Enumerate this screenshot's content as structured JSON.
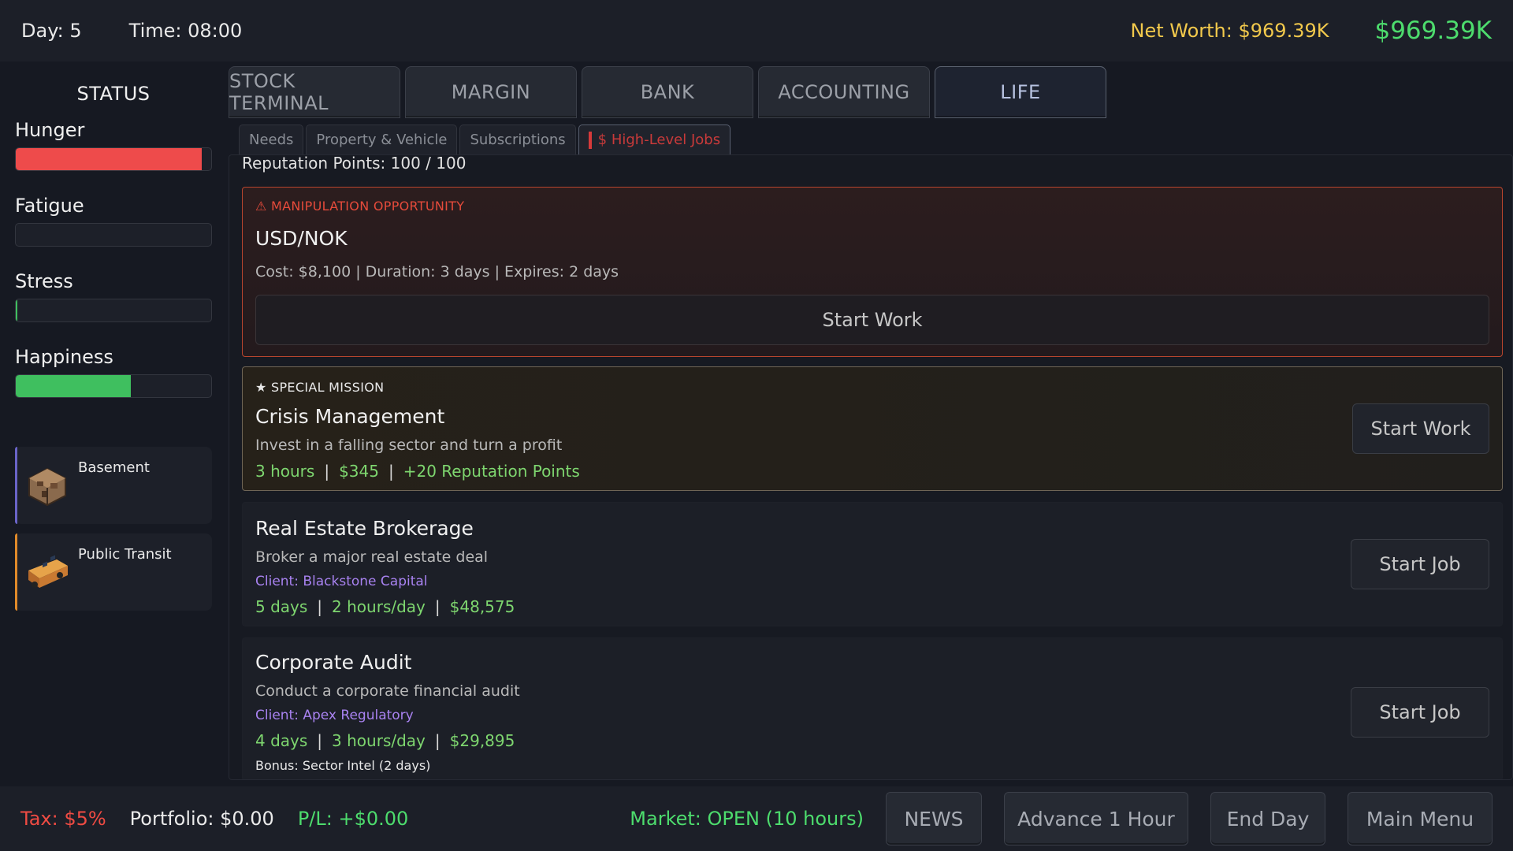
{
  "topbar": {
    "day": "Day: 5",
    "time": "Time: 08:00",
    "net_worth": "Net Worth: $969.39K",
    "cash": "$969.39K"
  },
  "sidebar": {
    "title": "STATUS",
    "meters": [
      {
        "label": "Hunger",
        "level": 0.95,
        "color": "#ee4b4b"
      },
      {
        "label": "Fatigue",
        "level": 0.0,
        "color": "#3fbf5f"
      },
      {
        "label": "Stress",
        "level": 0.005,
        "color": "#3fbf5f"
      },
      {
        "label": "Happiness",
        "level": 0.59,
        "color": "#3fbf5f"
      }
    ],
    "assets": [
      {
        "name": "Basement",
        "icon": "basement-room-icon",
        "accent": "#6a64c8"
      },
      {
        "name": "Public Transit",
        "icon": "bus-icon",
        "accent": "#e08a2a"
      }
    ]
  },
  "tabs": {
    "main": [
      "STOCK TERMINAL",
      "MARGIN",
      "BANK",
      "ACCOUNTING",
      "LIFE"
    ],
    "active_main": "LIFE",
    "sub": [
      "Needs",
      "Property & Vehicle",
      "Subscriptions",
      "$ High-Level Jobs"
    ],
    "active_sub": "$ High-Level Jobs"
  },
  "panel": {
    "reputation": "Reputation Points: 100 / 100",
    "manipulation": {
      "tag": "⚠ MANIPULATION OPPORTUNITY",
      "title": "USD/NOK",
      "details": "Cost: $8,100 | Duration: 3 days | Expires: 2 days",
      "button": "Start Work"
    },
    "special": {
      "tag": "★ SPECIAL MISSION",
      "title": "Crisis Management",
      "desc": "Invest in a falling sector and turn a profit",
      "stats": [
        "3 hours",
        "$345",
        "+20 Reputation Points"
      ],
      "button": "Start Work"
    },
    "jobs": [
      {
        "title": "Real Estate Brokerage",
        "desc": "Broker a major real estate deal",
        "client": "Client: Blackstone Capital",
        "stats": [
          "5 days",
          "2 hours/day",
          "$48,575"
        ],
        "bonus": "",
        "button": "Start Job"
      },
      {
        "title": "Corporate Audit",
        "desc": "Conduct a corporate financial audit",
        "client": "Client: Apex Regulatory",
        "stats": [
          "4 days",
          "3 hours/day",
          "$29,895"
        ],
        "bonus": "Bonus: Sector Intel (2 days)",
        "button": "Start Job"
      }
    ]
  },
  "bottombar": {
    "tax": "Tax: $5%",
    "portfolio": "Portfolio: $0.00",
    "pl": "P/L: +$0.00",
    "market": "Market: OPEN (10 hours)",
    "buttons": {
      "news": "NEWS",
      "advance": "Advance 1 Hour",
      "end_day": "End Day",
      "main_menu": "Main Menu"
    }
  }
}
